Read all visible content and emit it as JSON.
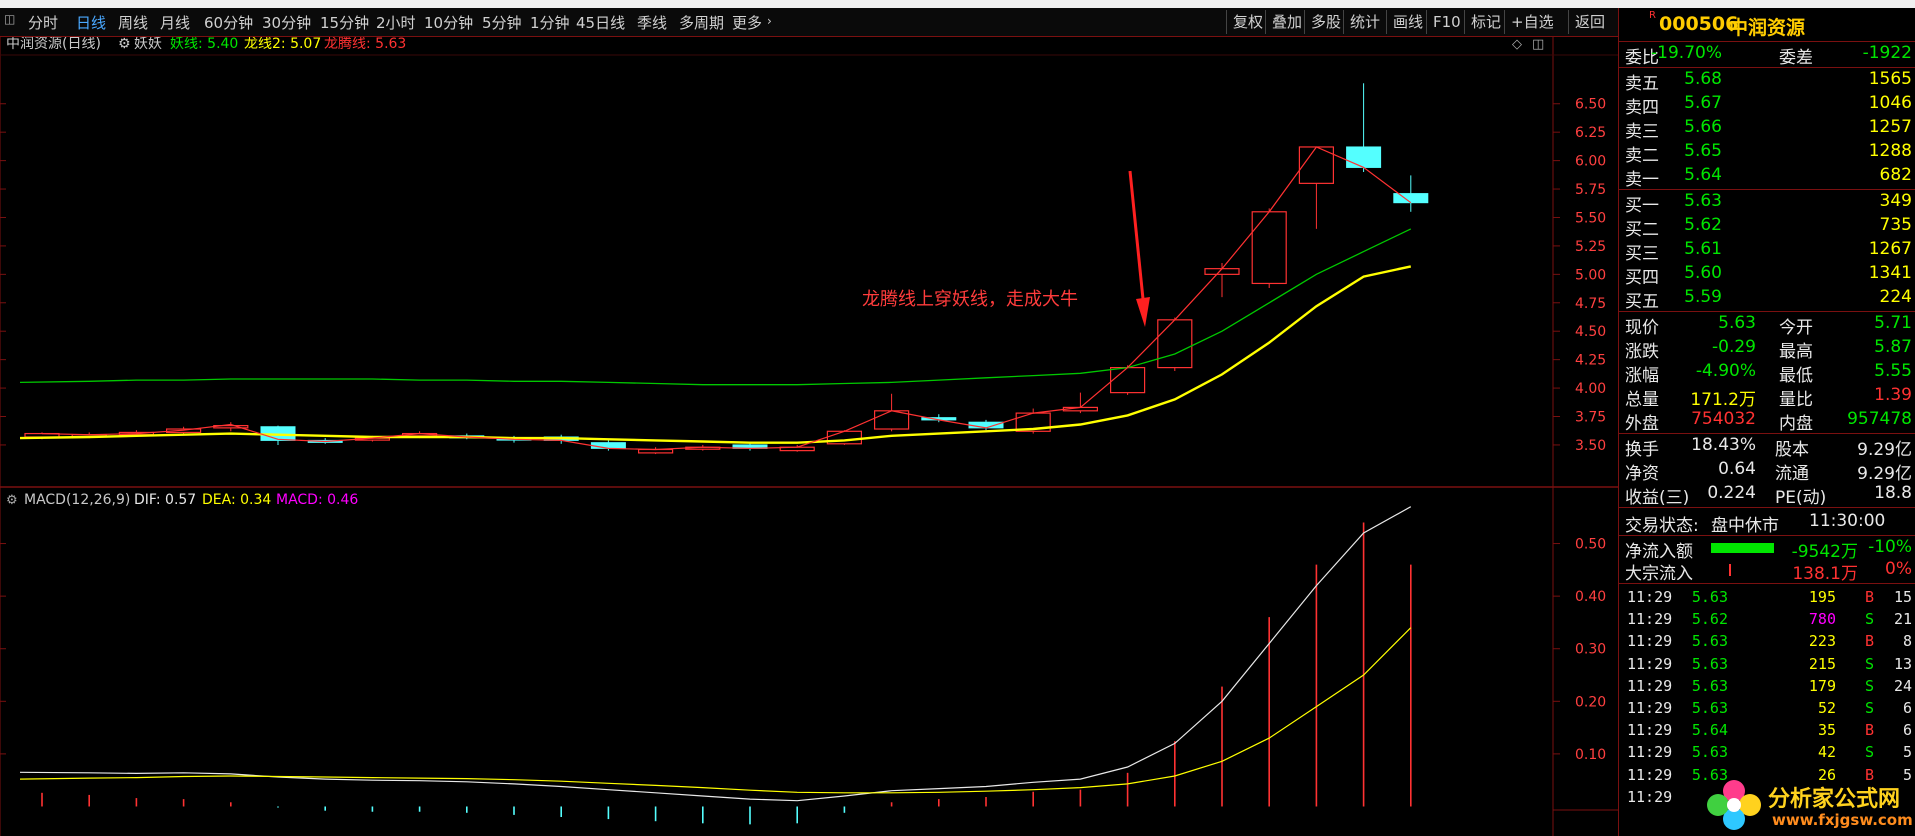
{
  "toolbar": {
    "periods": [
      "分时",
      "日线",
      "周线",
      "月线",
      "60分钟",
      "30分钟",
      "15分钟",
      "2小时",
      "10分钟",
      "5分钟",
      "1分钟",
      "45日线",
      "季线",
      "多周期",
      "更多"
    ],
    "active_period": "日线",
    "right_buttons": [
      "复权",
      "叠加",
      "多股",
      "统计",
      "画线",
      "F10",
      "标记",
      "+自选",
      "返回"
    ]
  },
  "chart_header": {
    "stock_label": "中润资源(日线)",
    "indicator_name": "妖妖",
    "yao_label": "妖线: 5.40",
    "long_label": "龙线2: 5.07",
    "longteng_label": "龙腾线: 5.63"
  },
  "macd_header": {
    "name": "MACD(12,26,9)",
    "dif": "DIF: 0.57",
    "dea": "DEA: 0.34",
    "macd": "MACD: 0.46"
  },
  "annotation": "龙腾线上穿妖线，走成大牛",
  "colors": {
    "up": "#ff3232",
    "down": "#54ffff",
    "yao_line": "#00c800",
    "long_line": "#ffff00",
    "longteng_line": "#ff3232",
    "dif": "#e8e8e8",
    "dea": "#ffff00",
    "grid": "#7a1010"
  },
  "chart_data": [
    {
      "type": "candlestick",
      "title": "中润资源(日线)",
      "yticks": [
        "6.50",
        "6.25",
        "6.00",
        "5.75",
        "5.50",
        "5.25",
        "5.00",
        "4.75",
        "4.50",
        "4.25",
        "4.00",
        "3.75",
        "3.50"
      ],
      "ylim": [
        3.35,
        6.7
      ],
      "x": [
        1,
        2,
        3,
        4,
        5,
        6,
        7,
        8,
        9,
        10,
        11,
        12,
        13,
        14,
        15,
        16,
        17,
        18,
        19,
        20,
        21,
        22,
        23,
        24,
        25,
        26,
        27,
        28,
        29,
        30
      ],
      "candles": [
        [
          3.57,
          3.6,
          3.55,
          3.61
        ],
        [
          3.58,
          3.59,
          3.56,
          3.61
        ],
        [
          3.59,
          3.61,
          3.57,
          3.63
        ],
        [
          3.61,
          3.64,
          3.59,
          3.66
        ],
        [
          3.65,
          3.67,
          3.62,
          3.7
        ],
        [
          3.66,
          3.54,
          3.5,
          3.67
        ],
        [
          3.54,
          3.53,
          3.51,
          3.56
        ],
        [
          3.55,
          3.56,
          3.53,
          3.58
        ],
        [
          3.58,
          3.6,
          3.56,
          3.62
        ],
        [
          3.58,
          3.57,
          3.55,
          3.6
        ],
        [
          3.56,
          3.55,
          3.52,
          3.58
        ],
        [
          3.57,
          3.54,
          3.51,
          3.59
        ],
        [
          3.52,
          3.47,
          3.45,
          3.54
        ],
        [
          3.43,
          3.46,
          3.42,
          3.48
        ],
        [
          3.47,
          3.48,
          3.45,
          3.5
        ],
        [
          3.5,
          3.47,
          3.45,
          3.52
        ],
        [
          3.45,
          3.48,
          3.44,
          3.5
        ],
        [
          3.51,
          3.62,
          3.5,
          3.63
        ],
        [
          3.64,
          3.8,
          3.62,
          3.95
        ],
        [
          3.74,
          3.72,
          3.7,
          3.77
        ],
        [
          3.7,
          3.65,
          3.63,
          3.72
        ],
        [
          3.62,
          3.78,
          3.6,
          3.82
        ],
        [
          3.8,
          3.83,
          3.78,
          3.96
        ],
        [
          3.96,
          4.18,
          3.94,
          4.2
        ],
        [
          4.18,
          4.6,
          4.15,
          4.62
        ],
        [
          5.0,
          5.05,
          4.8,
          5.1
        ],
        [
          4.92,
          5.55,
          4.88,
          5.58
        ],
        [
          5.8,
          6.12,
          5.4,
          6.12
        ],
        [
          6.12,
          5.94,
          5.9,
          6.68
        ],
        [
          5.71,
          5.63,
          5.55,
          5.87
        ]
      ],
      "series": [
        {
          "name": "妖线",
          "values": [
            4.05,
            4.06,
            4.07,
            4.07,
            4.08,
            4.08,
            4.08,
            4.08,
            4.07,
            4.07,
            4.06,
            4.06,
            4.05,
            4.04,
            4.03,
            4.03,
            4.03,
            4.04,
            4.05,
            4.07,
            4.09,
            4.11,
            4.13,
            4.18,
            4.3,
            4.5,
            4.75,
            5.0,
            5.2,
            5.4
          ]
        },
        {
          "name": "龙线2",
          "values": [
            3.56,
            3.57,
            3.58,
            3.59,
            3.6,
            3.59,
            3.58,
            3.57,
            3.57,
            3.57,
            3.56,
            3.56,
            3.55,
            3.54,
            3.53,
            3.52,
            3.52,
            3.54,
            3.58,
            3.6,
            3.62,
            3.64,
            3.68,
            3.76,
            3.9,
            4.12,
            4.4,
            4.72,
            4.98,
            5.07
          ]
        },
        {
          "name": "龙腾线",
          "values": [
            3.6,
            3.59,
            3.6,
            3.63,
            3.68,
            3.55,
            3.53,
            3.56,
            3.6,
            3.57,
            3.55,
            3.54,
            3.47,
            3.46,
            3.48,
            3.47,
            3.48,
            3.62,
            3.8,
            3.72,
            3.65,
            3.78,
            3.83,
            4.18,
            4.6,
            5.05,
            5.55,
            6.12,
            5.94,
            5.63
          ]
        }
      ]
    },
    {
      "type": "bar",
      "title": "MACD(12,26,9)",
      "yticks": [
        "0.50",
        "0.40",
        "0.30",
        "0.20",
        "0.10"
      ],
      "ylim": [
        -0.02,
        0.56
      ],
      "x": [
        1,
        2,
        3,
        4,
        5,
        6,
        7,
        8,
        9,
        10,
        11,
        12,
        13,
        14,
        15,
        16,
        17,
        18,
        19,
        20,
        21,
        22,
        23,
        24,
        25,
        26,
        27,
        28,
        29,
        30
      ],
      "series": [
        {
          "name": "DIF",
          "values": [
            0.065,
            0.064,
            0.063,
            0.064,
            0.062,
            0.056,
            0.052,
            0.05,
            0.049,
            0.047,
            0.043,
            0.038,
            0.032,
            0.026,
            0.02,
            0.014,
            0.011,
            0.02,
            0.03,
            0.034,
            0.038,
            0.046,
            0.052,
            0.075,
            0.12,
            0.2,
            0.31,
            0.42,
            0.52,
            0.57
          ]
        },
        {
          "name": "DEA",
          "values": [
            0.052,
            0.054,
            0.055,
            0.057,
            0.058,
            0.057,
            0.056,
            0.055,
            0.054,
            0.053,
            0.051,
            0.048,
            0.044,
            0.04,
            0.036,
            0.031,
            0.027,
            0.026,
            0.026,
            0.027,
            0.029,
            0.032,
            0.036,
            0.043,
            0.058,
            0.086,
            0.13,
            0.19,
            0.25,
            0.34
          ]
        },
        {
          "name": "MACD",
          "values": [
            0.026,
            0.022,
            0.016,
            0.014,
            0.008,
            -0.002,
            -0.008,
            -0.01,
            -0.01,
            -0.012,
            -0.016,
            -0.02,
            -0.024,
            -0.028,
            -0.032,
            -0.034,
            -0.032,
            -0.012,
            0.008,
            0.014,
            0.018,
            0.028,
            0.032,
            0.064,
            0.124,
            0.228,
            0.36,
            0.46,
            0.54,
            0.46
          ]
        }
      ]
    }
  ],
  "right_panel": {
    "code": "000506",
    "name": "中润资源",
    "weibi_label": "委比",
    "weibi_value": "-19.70%",
    "weicha_label": "委差",
    "weicha_value": "-1922",
    "sell": [
      {
        "label": "卖五",
        "price": "5.68",
        "vol": "1565"
      },
      {
        "label": "卖四",
        "price": "5.67",
        "vol": "1046"
      },
      {
        "label": "卖三",
        "price": "5.66",
        "vol": "1257"
      },
      {
        "label": "卖二",
        "price": "5.65",
        "vol": "1288"
      },
      {
        "label": "卖一",
        "price": "5.64",
        "vol": "682"
      }
    ],
    "buy": [
      {
        "label": "买一",
        "price": "5.63",
        "vol": "349"
      },
      {
        "label": "买二",
        "price": "5.62",
        "vol": "735"
      },
      {
        "label": "买三",
        "price": "5.61",
        "vol": "1267"
      },
      {
        "label": "买四",
        "price": "5.60",
        "vol": "1341"
      },
      {
        "label": "买五",
        "price": "5.59",
        "vol": "224"
      }
    ],
    "quote": [
      {
        "l1": "现价",
        "v1": "5.63",
        "c1": "green",
        "l2": "今开",
        "v2": "5.71",
        "c2": "green"
      },
      {
        "l1": "涨跌",
        "v1": "-0.29",
        "c1": "green",
        "l2": "最高",
        "v2": "5.87",
        "c2": "green"
      },
      {
        "l1": "涨幅",
        "v1": "-4.90%",
        "c1": "green",
        "l2": "最低",
        "v2": "5.55",
        "c2": "green"
      },
      {
        "l1": "总量",
        "v1": "171.2万",
        "c1": "yellow",
        "l2": "量比",
        "v2": "1.39",
        "c2": "red"
      },
      {
        "l1": "外盘",
        "v1": "754032",
        "c1": "red",
        "l2": "内盘",
        "v2": "957478",
        "c2": "green"
      }
    ],
    "fundamentals": [
      {
        "l1": "换手",
        "v1": "18.43%",
        "l2": "股本",
        "v2": "9.29亿"
      },
      {
        "l1": "净资",
        "v1": "0.64",
        "l2": "流通",
        "v2": "9.29亿"
      },
      {
        "l1": "收益(三)",
        "v1": "0.224",
        "l2": "PE(动)",
        "v2": "18.8"
      }
    ],
    "trade_status_label": "交易状态:",
    "trade_status_value": "盘中休市",
    "trade_time": "11:30:00",
    "net_inflow_label": "净流入额",
    "net_inflow_value": "-9542万",
    "net_inflow_pct": "-10%",
    "net_inflow_bar": 0.7,
    "bulk_inflow_label": "大宗流入",
    "bulk_inflow_value": "138.1万",
    "bulk_inflow_pct": "0%",
    "ticks": [
      {
        "t": "11:29",
        "p": "5.63",
        "pc": "green",
        "v": "195",
        "vc": "yellow",
        "d": "B",
        "n": "15"
      },
      {
        "t": "11:29",
        "p": "5.62",
        "pc": "green",
        "v": "780",
        "vc": "magenta",
        "d": "S",
        "n": "21"
      },
      {
        "t": "11:29",
        "p": "5.63",
        "pc": "green",
        "v": "223",
        "vc": "yellow",
        "d": "B",
        "n": "8"
      },
      {
        "t": "11:29",
        "p": "5.63",
        "pc": "green",
        "v": "215",
        "vc": "yellow",
        "d": "S",
        "n": "13"
      },
      {
        "t": "11:29",
        "p": "5.63",
        "pc": "green",
        "v": "179",
        "vc": "yellow",
        "d": "S",
        "n": "24"
      },
      {
        "t": "11:29",
        "p": "5.63",
        "pc": "green",
        "v": "52",
        "vc": "yellow",
        "d": "S",
        "n": "6"
      },
      {
        "t": "11:29",
        "p": "5.64",
        "pc": "green",
        "v": "35",
        "vc": "yellow",
        "d": "B",
        "n": "6"
      },
      {
        "t": "11:29",
        "p": "5.63",
        "pc": "green",
        "v": "42",
        "vc": "yellow",
        "d": "S",
        "n": "5"
      },
      {
        "t": "11:29",
        "p": "5.63",
        "pc": "green",
        "v": "26",
        "vc": "yellow",
        "d": "B",
        "n": "5"
      },
      {
        "t": "11:29",
        "p": "",
        "pc": "green",
        "v": "",
        "vc": "yellow",
        "d": "",
        "n": ""
      }
    ]
  },
  "watermark": {
    "title": "分析家公式网",
    "url": "www.fxjgsw.com"
  }
}
